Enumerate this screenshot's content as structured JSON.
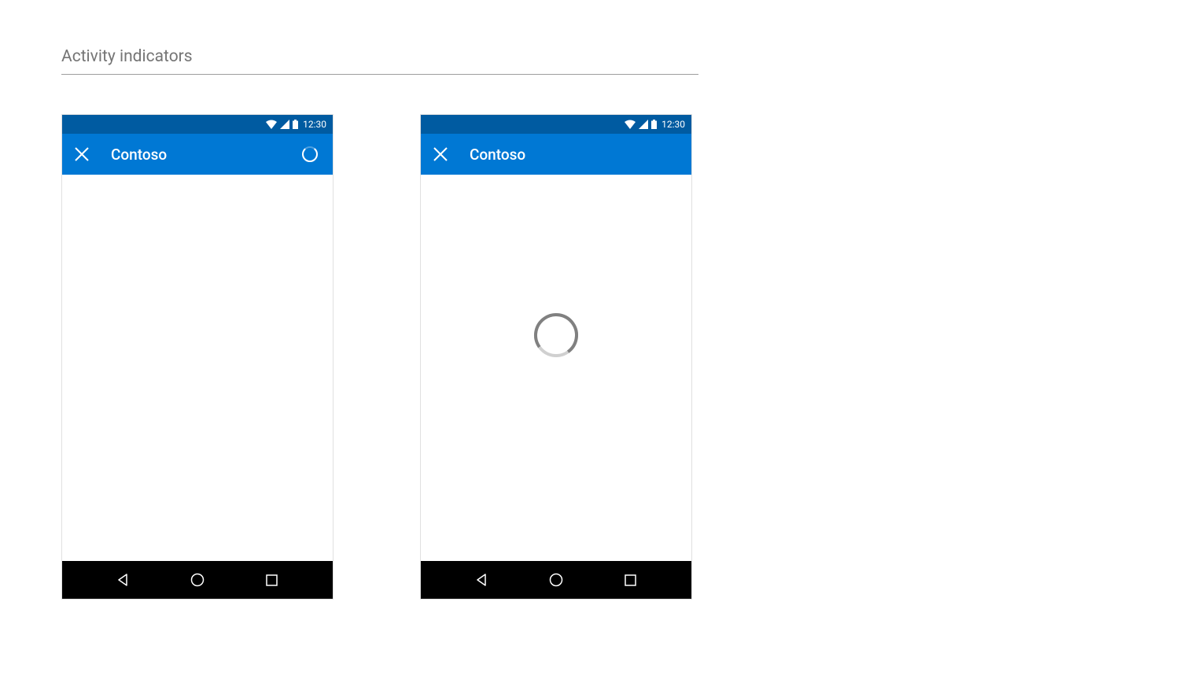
{
  "page": {
    "title": "Activity indicators"
  },
  "phones": [
    {
      "status_time": "12:30",
      "app_title": "Contoso",
      "show_appbar_spinner": true,
      "show_center_spinner": false
    },
    {
      "status_time": "12:30",
      "app_title": "Contoso",
      "show_appbar_spinner": false,
      "show_center_spinner": true
    }
  ],
  "colors": {
    "status_bar": "#005ba1",
    "app_bar": "#0078d4",
    "nav_bar": "#000000",
    "spinner_gray": "#9e9e9e"
  }
}
